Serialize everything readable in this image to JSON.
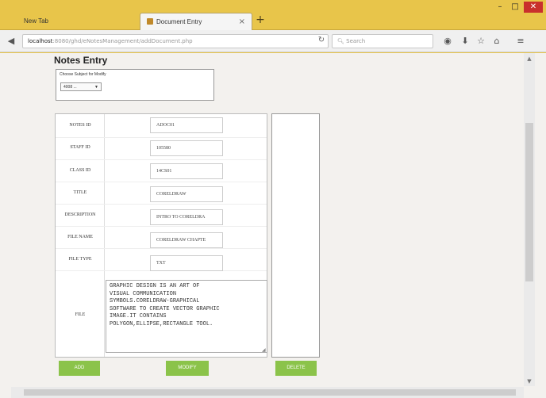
{
  "browser": {
    "tabs": [
      {
        "label": "New Tab"
      },
      {
        "label": "Document Entry"
      }
    ],
    "url_host": "localhost",
    "url_path": ":8080/ghd/eNotesManagement/addDocument.php",
    "search_placeholder": "Search",
    "window_controls": {
      "min": "–",
      "max": "□",
      "close": "✕"
    }
  },
  "page": {
    "title": "Notes Entry",
    "choose_label": "Choose Subject for Modify",
    "choose_value": "4008 ..."
  },
  "form": {
    "rows": [
      {
        "label": "NOTES ID",
        "value": "ADOC01"
      },
      {
        "label": "STAFF ID",
        "value": "105580"
      },
      {
        "label": "CLASS ID",
        "value": "14CS01"
      },
      {
        "label": "TITLE",
        "value": "CORELDRAW"
      },
      {
        "label": "DESCRIPTION",
        "value": "INTRO TO CORELDRA"
      },
      {
        "label": "FILE NAME",
        "value": "CORELDRAW CHAPTE"
      },
      {
        "label": "FILE TYPE",
        "value": "TXT"
      }
    ],
    "file_label": "FILE",
    "file_content": "GRAPHIC DESIGN IS AN ART OF\nVISUAL COMMUNICATION\nSYMBOLS.CORELDRAW-GRAPHICAL\nSOFTWARE TO CREATE VECTOR GRAPHIC\nIMAGE.IT CONTAINS\nPOLYGON,ELLIPSE,RECTANGLE TOOL."
  },
  "buttons": {
    "add": "ADD",
    "modify": "MODIFY",
    "delete": "DELETE"
  },
  "colors": {
    "titlebar": "#e8c54a",
    "button_green": "#8bc34a",
    "close_red": "#c9302c"
  }
}
